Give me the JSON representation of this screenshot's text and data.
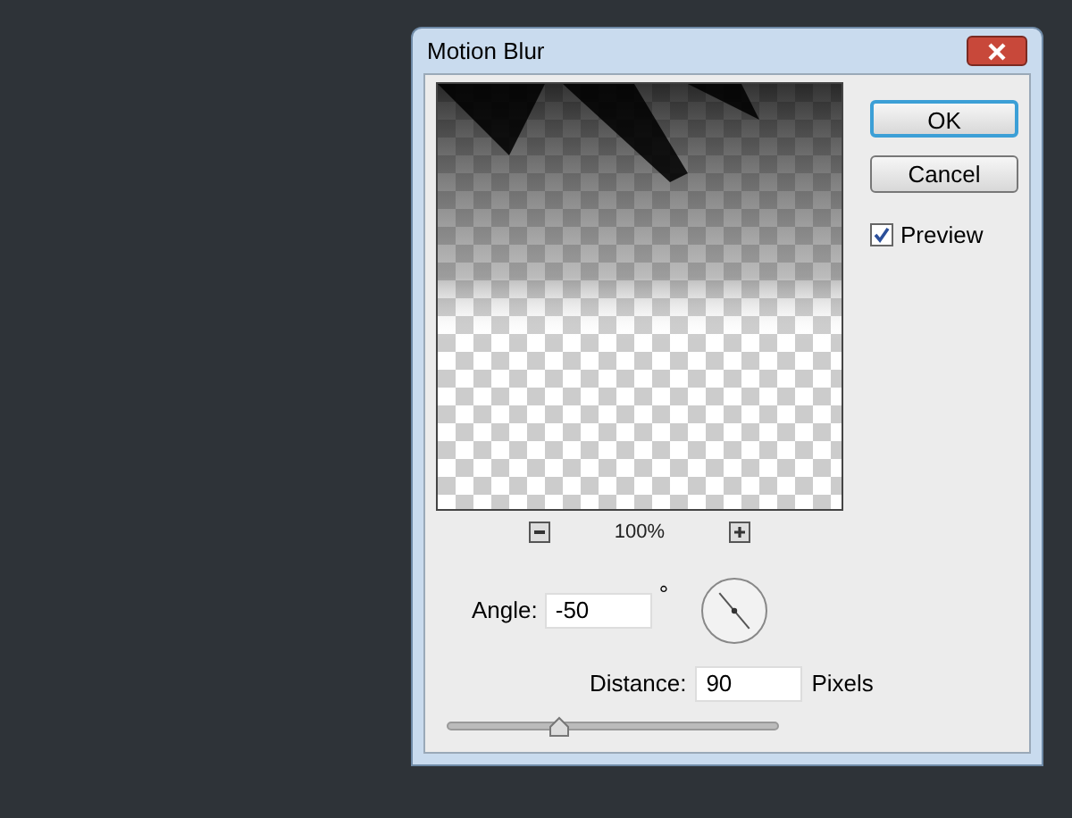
{
  "dialog": {
    "title": "Motion Blur",
    "buttons": [
      {
        "label": "OK",
        "default": true
      },
      {
        "label": "Cancel",
        "default": false
      }
    ],
    "preview": {
      "label": "Preview",
      "checked": true
    },
    "zoom": "100%",
    "angle": {
      "label": "Angle:",
      "value": "-50",
      "unit": "°"
    },
    "distance": {
      "label": "Distance:",
      "value": "90",
      "unit": "Pixels",
      "level": 0.34
    }
  }
}
